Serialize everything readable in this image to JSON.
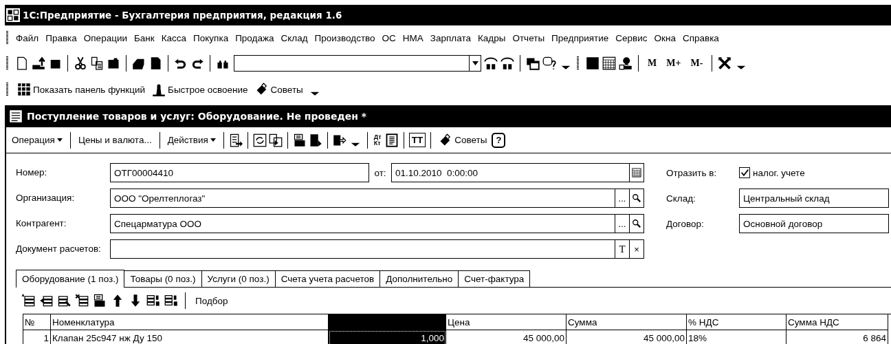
{
  "window": {
    "title": "1С:Предприятие - Бухгалтерия предприятия, редакция 1.6"
  },
  "menu": [
    {
      "label": "Файл"
    },
    {
      "label": "Правка"
    },
    {
      "label": "Операции"
    },
    {
      "label": "Банк"
    },
    {
      "label": "Касса"
    },
    {
      "label": "Покупка"
    },
    {
      "label": "Продажа"
    },
    {
      "label": "Склад"
    },
    {
      "label": "Производство"
    },
    {
      "label": "ОС"
    },
    {
      "label": "НМА"
    },
    {
      "label": "Зарплата"
    },
    {
      "label": "Кадры"
    },
    {
      "label": "Отчеты"
    },
    {
      "label": "Предприятие"
    },
    {
      "label": "Сервис"
    },
    {
      "label": "Окна"
    },
    {
      "label": "Справка"
    }
  ],
  "toolbar": {
    "memory_buttons": [
      "M",
      "M+",
      "M-"
    ]
  },
  "panel_toolbar": {
    "buttons": [
      "Показать панель функций",
      "Быстрое освоение",
      "Советы"
    ]
  },
  "document": {
    "title": "Поступление товаров и услуг: Оборудование. Не проведен *",
    "toolbar": {
      "operation": "Операция",
      "prices": "Цены и валюта...",
      "actions": "Действия",
      "dt_kt": [
        "Дт",
        "Кт"
      ],
      "font_toggle": {
        "label": "ТТ",
        "pressed": true
      },
      "tips": "Советы",
      "help": "?"
    },
    "form": {
      "number": {
        "label": "Номер:",
        "value": "ОТГ00004410"
      },
      "date": {
        "label": "от:",
        "value": "01.10.2010  0:00:00"
      },
      "reflect": {
        "label": "Отразить в:",
        "option": "налог. учете",
        "checked": true
      },
      "organization": {
        "label": "Организация:",
        "value": "ООО \"Орелтеплогаз\"",
        "select_button": "..."
      },
      "warehouse": {
        "label": "Склад:",
        "value": "Центральный склад"
      },
      "contractor": {
        "label": "Контрагент:",
        "value": "Спецарматура ООО",
        "select_button": "..."
      },
      "contract": {
        "label": "Договор:",
        "value": "Основной договор"
      },
      "settlement_document": {
        "label": "Документ расчетов:",
        "buttons": [
          "T",
          "×"
        ]
      }
    },
    "tabs": [
      {
        "label": "Оборудование (1 поз.)",
        "selected": true
      },
      {
        "label": "Товары (0 поз.)",
        "selected": false
      },
      {
        "label": "Услуги (0 поз.)",
        "selected": false
      },
      {
        "label": "Счета учета расчетов",
        "selected": false
      },
      {
        "label": "Дополнительно",
        "selected": false
      },
      {
        "label": "Счет-фактура",
        "selected": false
      }
    ],
    "table_toolbar": {
      "pick_button": "Подбор"
    },
    "table": {
      "columns": [
        {
          "label": "№",
          "current": false
        },
        {
          "label": "Номенклатура",
          "current": false
        },
        {
          "current": true
        },
        {
          "label": "Цена",
          "current": false
        },
        {
          "label": "Сумма",
          "current": false
        },
        {
          "label": "% НДС",
          "current": false
        },
        {
          "label": "Сумма НДС",
          "current": false
        }
      ],
      "rows": [
        {
          "cells": [
            "1",
            "Клапан 25с947 нж Ду 150",
            "1,000",
            "45 000,00",
            "45 000,00",
            "18%",
            "6 864"
          ]
        }
      ]
    }
  }
}
